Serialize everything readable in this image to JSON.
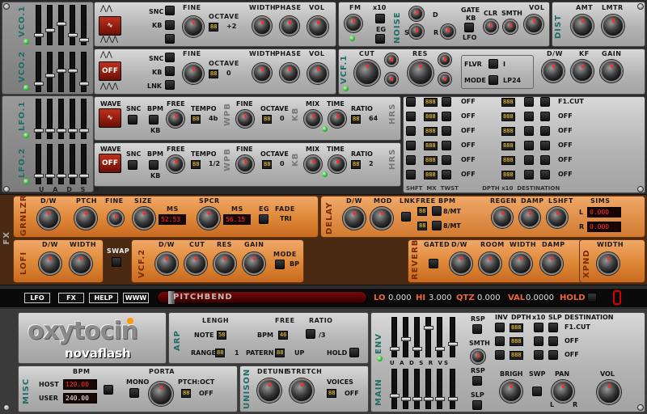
{
  "vco1": {
    "title": "VCO.1",
    "snc": "SNC",
    "kb": "KB",
    "fine": "FINE",
    "octave": "OCTAVE",
    "octave_value": "+2",
    "width": "WIDTH",
    "phase": "PHASE",
    "vol": "VOL"
  },
  "vco2": {
    "title": "VCO.2",
    "wave_value": "OFF",
    "snc": "SNC",
    "kb": "KB",
    "lnk": "LNK",
    "fine": "FINE",
    "octave": "OCTAVE",
    "octave_value": "0",
    "width": "WIDTH",
    "phase": "PHASE",
    "vol": "VOL"
  },
  "noise": {
    "title": "NOISE",
    "fm": "FM",
    "x10": "x10",
    "eg": "EG",
    "d": "D",
    "s": "S",
    "r": "R",
    "gate": "GATE",
    "kb": "KB",
    "lfo": "LFO",
    "clr": "CLR",
    "smth": "SMTH",
    "vol": "VOL"
  },
  "dist": {
    "title": "DIST",
    "amt": "AMT",
    "lmtr": "LMTR"
  },
  "vcf1": {
    "title": "VCF.1",
    "cut": "CUT",
    "res": "RES",
    "flvr": "FLVR",
    "flvr_value": "I",
    "mode": "MODE",
    "mode_value": "LP24",
    "dw": "D/W",
    "kf": "KF",
    "gain": "GAIN"
  },
  "lfo1": {
    "title": "LFO.1",
    "wave": "WAVE",
    "snc": "SNC",
    "bpm": "BPM",
    "kb": "KB",
    "free": "FREE",
    "tempo": "TEMPO",
    "tempo_value": "4b",
    "wpb": "WPB",
    "fine": "FINE",
    "octave": "OCTAVE",
    "octave_value": "0",
    "kb2": "KB",
    "mix": "MIX",
    "time": "TIME",
    "ratio": "RATIO",
    "ratio_value": "64",
    "hrs": "HRS"
  },
  "lfo2": {
    "title": "LFO.2",
    "wave": "WAVE",
    "wave_value": "OFF",
    "snc": "SNC",
    "bpm": "BPM",
    "kb": "KB",
    "free": "FREE",
    "tempo": "TEMPO",
    "tempo_value": "1/2",
    "wpb": "WPB",
    "fine": "FINE",
    "octave": "OCTAVE",
    "octave_value": "0",
    "kb2": "KB",
    "mix": "MIX",
    "time": "TIME",
    "ratio": "RATIO",
    "ratio_value": "2",
    "hrs": "HRS"
  },
  "adsr": {
    "labels": "U A D S R"
  },
  "mod_matrix": {
    "rows": [
      {
        "left": "888",
        "left_dest": "OFF",
        "right": "888",
        "right_dest": "F1.CUT"
      },
      {
        "left": "888",
        "left_dest": "OFF",
        "right": "888",
        "right_dest": "OFF"
      },
      {
        "left": "888",
        "left_dest": "OFF",
        "right": "888",
        "right_dest": "OFF"
      },
      {
        "left": "888",
        "left_dest": "OFF",
        "right": "888",
        "right_dest": "OFF"
      },
      {
        "left": "888",
        "left_dest": "OFF",
        "right": "888",
        "right_dest": "OFF"
      },
      {
        "left": "888",
        "left_dest": "OFF",
        "right": "888",
        "right_dest": "OFF"
      }
    ],
    "footer": "SHFT  MX  TWST            DPTH x10  DESTINATION"
  },
  "fx_label": "FX",
  "grnlzr": {
    "title": "GRNLZR",
    "dw": "D/W",
    "ptch": "PTCH",
    "fine": "FINE",
    "size": "SIZE",
    "ms": "MS",
    "ms_value": "52.53",
    "spcr": "SPCR",
    "ms2": "MS",
    "ms2_value": "56.15",
    "eg": "EG",
    "fade": "FADE",
    "fade_value": "TRI"
  },
  "delay": {
    "title": "DELAY",
    "dw": "D/W",
    "mod": "MOD",
    "lnk": "LNK",
    "free": "FREE",
    "bpm": "BPM",
    "l_rate": "8/MT",
    "r_rate": "8/MT",
    "seg_l": "88",
    "seg_r": "88",
    "regen": "REGEN",
    "damp": "DAMP",
    "lshft": "LSHFT",
    "sims": "SIMS",
    "l": "L",
    "r": "R",
    "l_value": "0.000",
    "r_value": "0.000"
  },
  "lofi": {
    "title": "LOFI",
    "dw": "D/W",
    "width": "WIDTH"
  },
  "swap": "SWAP",
  "vcf2": {
    "title": "VCF.2",
    "dw": "D/W",
    "cut": "CUT",
    "res": "RES",
    "gain": "GAIN",
    "mode": "MODE",
    "mode_value": "BP"
  },
  "reverb": {
    "title": "REVERB",
    "gated": "GATED",
    "dw": "D/W",
    "room": "ROOM",
    "width": "WIDTH",
    "damp": "DAMP"
  },
  "xpnd": {
    "title": "XPND",
    "width": "WIDTH"
  },
  "toolbar": {
    "lfo": "LFO",
    "fx": "FX",
    "help": "HELP",
    "www": "WWW",
    "pitchbend": "PITCHBEND",
    "lo_label": "LO",
    "lo_value": "0.000",
    "hi_label": "HI",
    "hi_value": "3.000",
    "qtz_label": "QTZ",
    "qtz_value": "0.000",
    "val_label": "VAL",
    "val_value": "0.0000",
    "hold": "HOLD"
  },
  "brand": {
    "name": "oxytocin",
    "maker": "novaflash"
  },
  "arp": {
    "title": "ARP",
    "lengh": "LENGH",
    "note": "NOTE",
    "note_value": "58",
    "range": "RANGE",
    "range_value": "1",
    "free": "FREE",
    "bpm": "BPM",
    "bpm_value": "46",
    "patern": "PATERN",
    "patern_value": "UP",
    "ratio": "RATIO",
    "ratio_value": "/3",
    "hold": "HOLD"
  },
  "misc": {
    "title": "MISC",
    "bpm": "BPM",
    "host": "HOST",
    "host_value": "120.00",
    "user": "USER",
    "user_value": "240.00",
    "porta": "PORTA",
    "mono": "MONO",
    "ptch_oct": "PTCH:OCT",
    "ptch_oct_value": "OFF"
  },
  "unison": {
    "title": "UNISON",
    "detune": "DETUNE",
    "stretch": "STRETCH",
    "voices": "VOICES",
    "voices_value": "OFF"
  },
  "env": {
    "title": "ENV",
    "labels": "U A D S R VS",
    "rsp1": "RSP",
    "smth": "SMTH",
    "rsp2": "RSP",
    "slp": "SLP",
    "inv": "INV",
    "dpth": "DPTH",
    "x10": "x10",
    "slp2": "SLP",
    "destination": "DESTINATION",
    "dest_rows": [
      "F1.CUT",
      "OFF",
      "OFF"
    ]
  },
  "main": {
    "title": "MAIN",
    "brigh": "BRIGH",
    "swp": "SWP",
    "pan": "PAN",
    "l": "L",
    "r": "R",
    "vol": "VOL"
  }
}
